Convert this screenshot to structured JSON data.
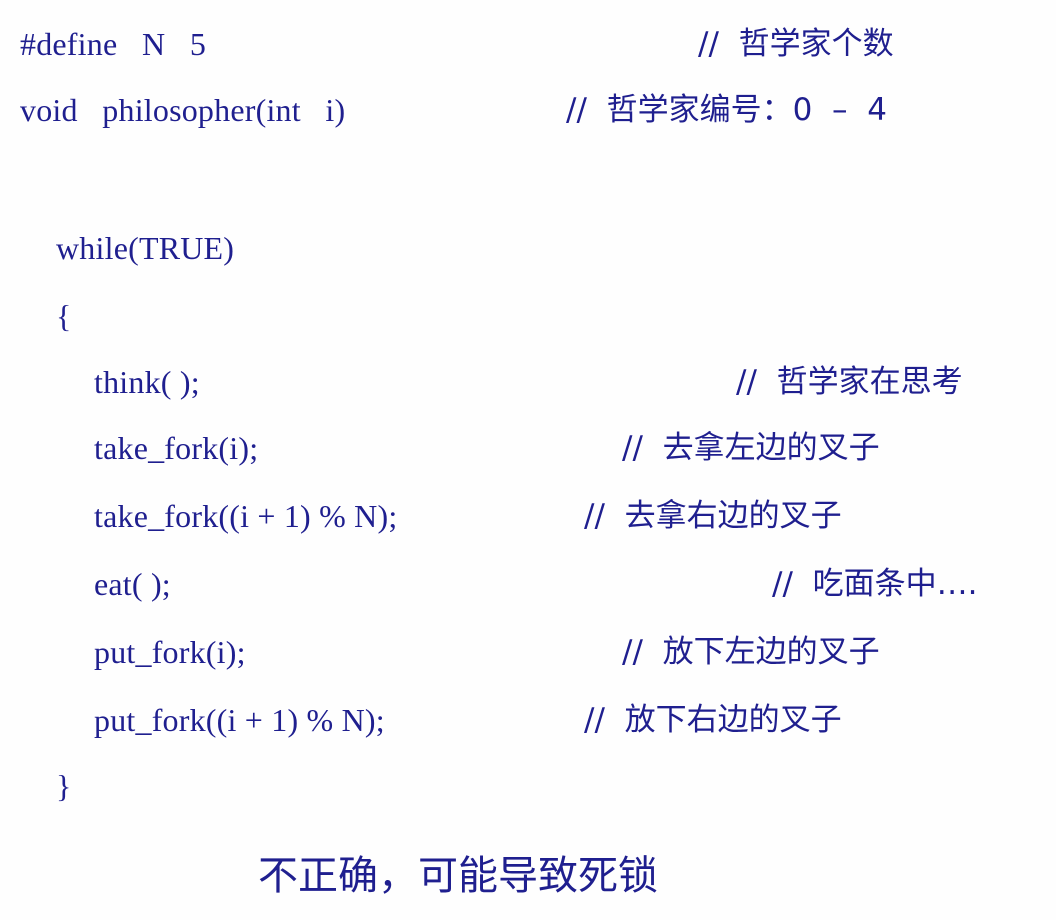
{
  "colors": {
    "text": "#1f1f8f",
    "background": "#fefefe"
  },
  "code": {
    "define": "#define   N   5",
    "define_comment": "//  哲学家个数",
    "func": "void   philosopher(int   i)",
    "func_comment": "//  哲学家编号：0  –  4",
    "while": "while(TRUE)",
    "open_brace": "{",
    "think": "think( );",
    "think_comment": "//  哲学家在思考",
    "take_left": "take_fork(i);",
    "take_left_comment": "//  去拿左边的叉子",
    "take_right": "take_fork((i + 1) % N);",
    "take_right_comment": "//  去拿右边的叉子",
    "eat": "eat( );",
    "eat_comment": "//  吃面条中….",
    "put_left": "put_fork(i);",
    "put_left_comment": "//  放下左边的叉子",
    "put_right": "put_fork((i + 1) % N);",
    "put_right_comment": "//  放下右边的叉子",
    "close_brace": "}"
  },
  "note": "不正确，可能导致死锁"
}
